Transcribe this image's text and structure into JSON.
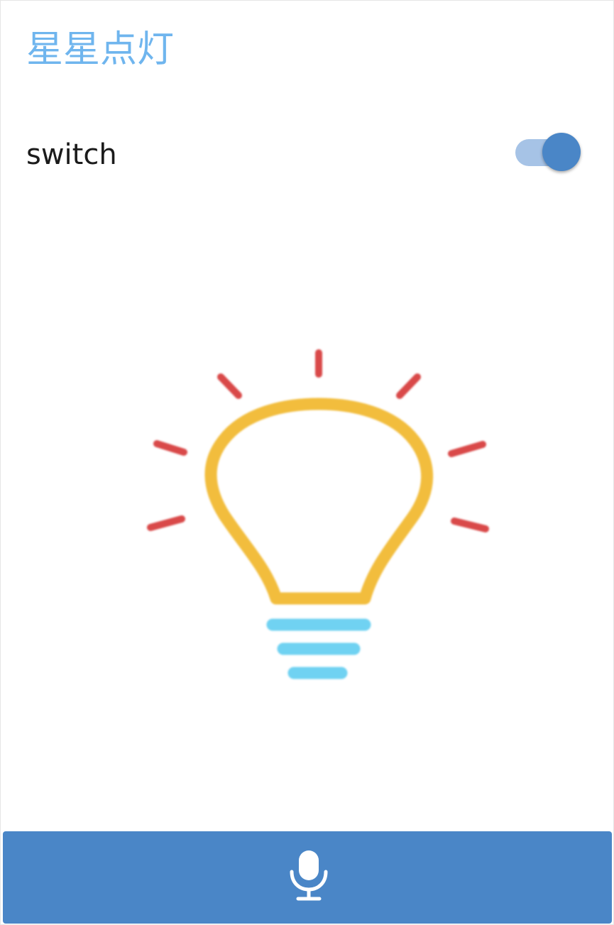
{
  "header": {
    "title": "星星点灯"
  },
  "switch": {
    "label": "switch",
    "state": "on"
  },
  "bulb": {
    "icon": "lightbulb-icon",
    "ray_color": "#d94a4a",
    "outline_color": "#f2bd3c",
    "base_color": "#6fd2f2"
  },
  "footer": {
    "icon": "microphone-icon",
    "bar_color": "#4a86c7"
  },
  "colors": {
    "title": "#6fb5ee",
    "toggle_track": "#a6c3e6",
    "toggle_knob": "#4a86c7"
  }
}
